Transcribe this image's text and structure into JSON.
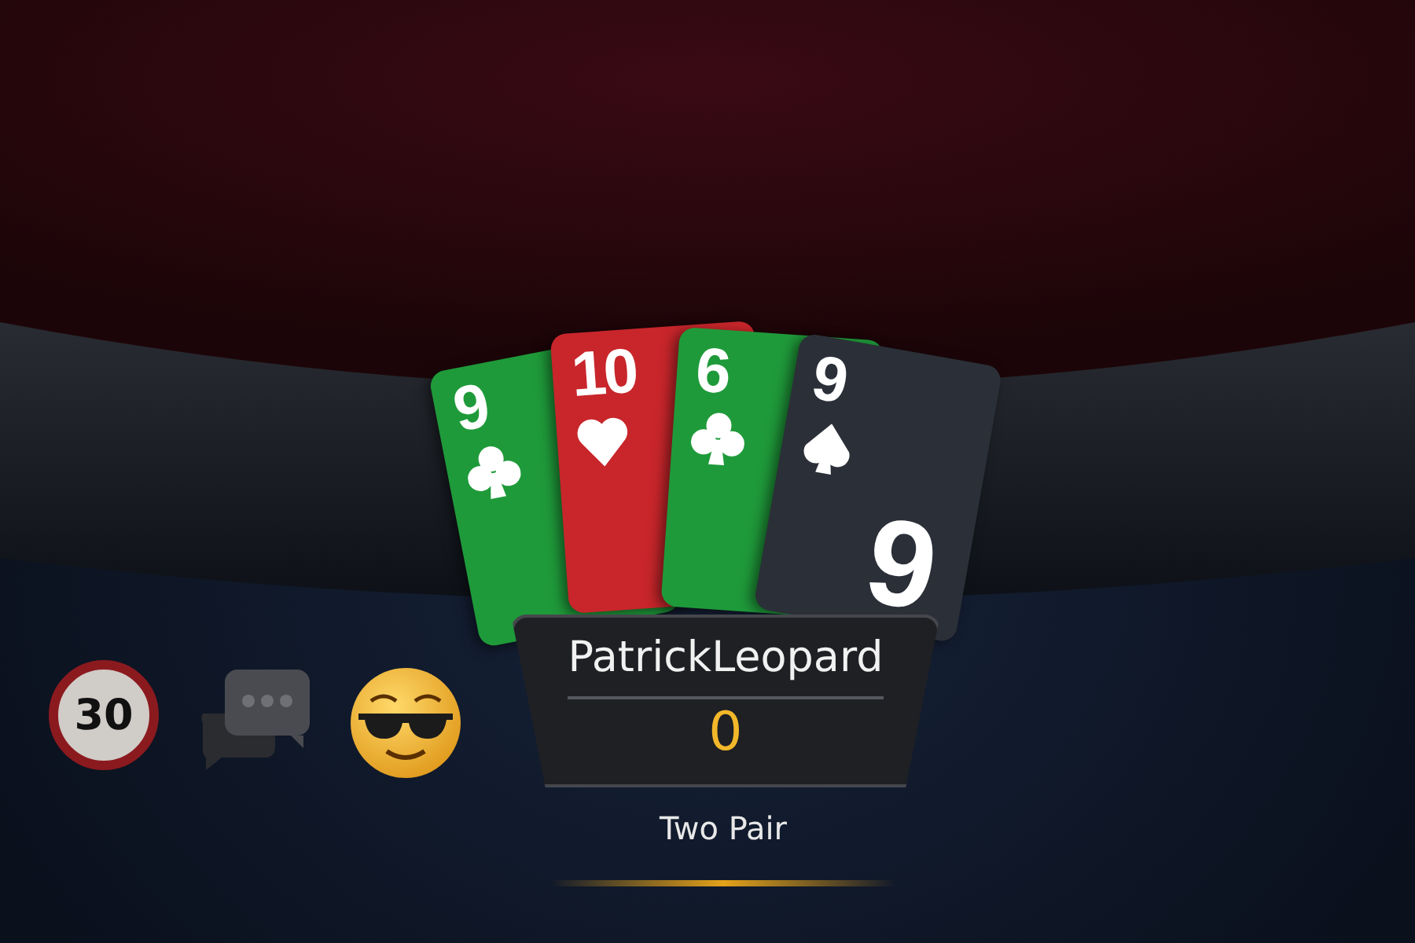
{
  "timer": {
    "seconds": "30"
  },
  "cards": [
    {
      "rank": "9",
      "kind": "clubs"
    },
    {
      "rank": "10",
      "kind": "hearts"
    },
    {
      "rank": "6",
      "kind": "clubs"
    },
    {
      "rank": "9",
      "kind": "spades",
      "center_rank": "9"
    }
  ],
  "player": {
    "name": "PatrickLeopard",
    "chips": "0",
    "hand": "Two Pair"
  }
}
